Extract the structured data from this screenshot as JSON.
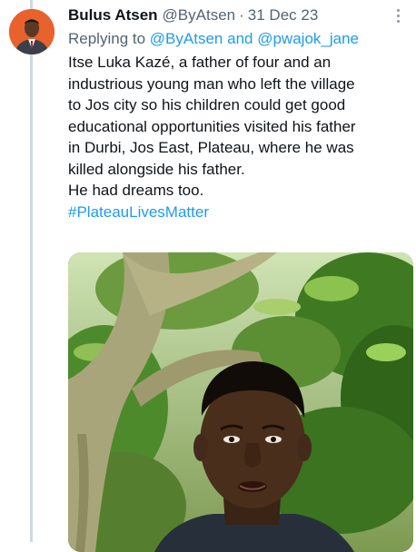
{
  "author": {
    "name": "Bulus Atsen",
    "handle": "@ByAtsen",
    "separator": "·",
    "date": "31 Dec 23",
    "avatar_icon": "person-in-suit-avatar",
    "avatar_bg": "#e8622d"
  },
  "replying": {
    "prefix": "Replying to",
    "mention_1": "@ByAtsen",
    "conjunction": "and",
    "mention_2": "@pwajok_jane"
  },
  "body": {
    "line_1": "Itse Luka Kazé, a father of four and an",
    "line_2": "industrious young man who left the village",
    "line_3": "to Jos city so his children could get good",
    "line_4": "educational opportunities visited his father",
    "line_5": "in Durbi, Jos East, Plateau, where he was",
    "line_6": "killed alongside his father.",
    "line_7": "He had dreams too.",
    "hashtag": "#PlateauLivesMatter"
  },
  "media": {
    "icon": "photo-of-man-under-tree"
  },
  "colors": {
    "link": "#1d9bf0",
    "secondary_text": "#536471",
    "thread_line": "#cfd9de"
  }
}
